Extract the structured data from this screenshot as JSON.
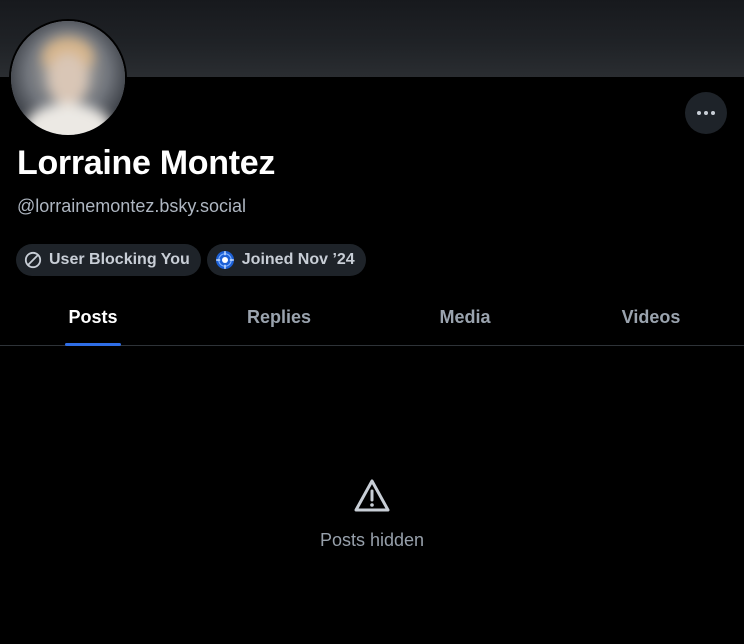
{
  "profile": {
    "display_name": "Lorraine Montez",
    "handle": "@lorrainemontez.bsky.social"
  },
  "badges": [
    {
      "label": "User Blocking You",
      "icon": "block-icon"
    },
    {
      "label": "Joined Nov ’24",
      "icon": "starter-pack-icon"
    }
  ],
  "tabs": [
    {
      "label": "Posts",
      "active": true
    },
    {
      "label": "Replies",
      "active": false
    },
    {
      "label": "Media",
      "active": false
    },
    {
      "label": "Videos",
      "active": false
    }
  ],
  "empty_state": {
    "icon": "warning-icon",
    "text": "Posts hidden"
  },
  "colors": {
    "background": "#000000",
    "accent": "#2f6ee6",
    "pill_background": "#1e2329",
    "muted_text": "#97a0ab"
  }
}
